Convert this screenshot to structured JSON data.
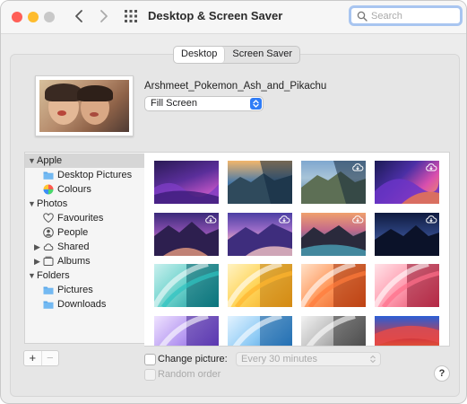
{
  "window": {
    "title": "Desktop & Screen Saver"
  },
  "search": {
    "placeholder": "Search",
    "value": ""
  },
  "tabs": [
    {
      "label": "Desktop",
      "selected": true
    },
    {
      "label": "Screen Saver",
      "selected": false
    }
  ],
  "current": {
    "filename": "Arshmeet_Pokemon_Ash_and_Pikachu",
    "fit_option": "Fill Screen"
  },
  "sidebar": {
    "sections": [
      {
        "label": "Apple",
        "expanded": true,
        "selected": true,
        "items": [
          {
            "label": "Desktop Pictures",
            "icon": "folder-icon"
          },
          {
            "label": "Colours",
            "icon": "color-wheel-icon"
          }
        ]
      },
      {
        "label": "Photos",
        "expanded": true,
        "items": [
          {
            "label": "Favourites",
            "icon": "heart-icon"
          },
          {
            "label": "People",
            "icon": "person-icon"
          },
          {
            "label": "Shared",
            "icon": "cloud-icon",
            "collapsed": true
          },
          {
            "label": "Albums",
            "icon": "album-icon",
            "collapsed": true
          }
        ]
      },
      {
        "label": "Folders",
        "expanded": true,
        "items": [
          {
            "label": "Pictures",
            "icon": "folder-icon"
          },
          {
            "label": "Downloads",
            "icon": "folder-icon"
          }
        ]
      }
    ]
  },
  "gallery": {
    "wallpapers": [
      {
        "name": "monterey-dark-purple",
        "cloud": false
      },
      {
        "name": "catalina-coast-blend",
        "cloud": false
      },
      {
        "name": "catalina-island-day",
        "cloud": true
      },
      {
        "name": "monterey-violet-graphic",
        "cloud": true
      },
      {
        "name": "big-sur-evening",
        "cloud": true
      },
      {
        "name": "big-sur-dusk",
        "cloud": true
      },
      {
        "name": "big-sur-coast",
        "cloud": true
      },
      {
        "name": "big-sur-night",
        "cloud": true
      },
      {
        "name": "ipad-teal",
        "cloud": false
      },
      {
        "name": "ipad-yellow",
        "cloud": false
      },
      {
        "name": "ipad-orange",
        "cloud": false
      },
      {
        "name": "ipad-pink",
        "cloud": false
      },
      {
        "name": "ipad-purple",
        "cloud": false
      },
      {
        "name": "ipad-blue",
        "cloud": false
      },
      {
        "name": "ipad-gray",
        "cloud": false
      },
      {
        "name": "ipad-red",
        "cloud": false
      }
    ]
  },
  "footer": {
    "change_picture_label": "Change picture:",
    "change_picture_checked": false,
    "interval": "Every 30 minutes",
    "random_order_label": "Random order",
    "add_symbol": "+",
    "remove_symbol": "−",
    "help_symbol": "?"
  },
  "colors": {
    "accent": "#2f7cf6",
    "selection": "#d6d6d6"
  }
}
